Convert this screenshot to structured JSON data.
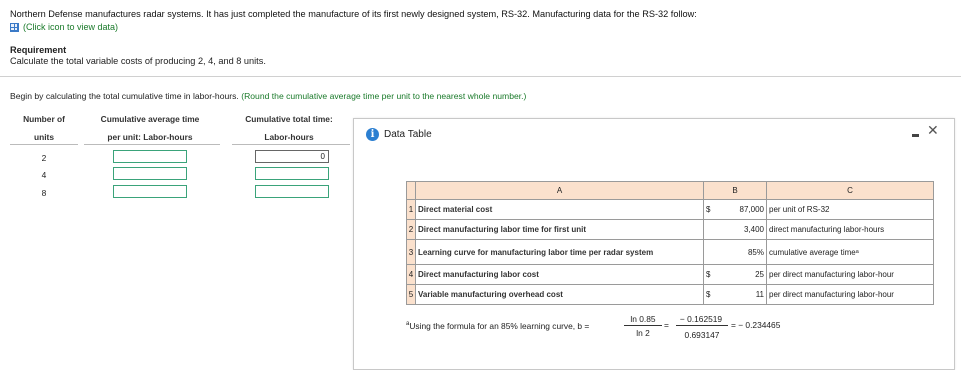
{
  "intro": "Northern Defense manufactures radar systems. It has just completed the manufacture of its first newly designed system, RS-32. Manufacturing data for the RS-32 follow:",
  "view_data_link": "(Click icon to view data)",
  "requirement_title": "Requirement",
  "requirement_text": "Calculate the total variable costs of producing 2, 4, and 8 units.",
  "instruction": "Begin by calculating the total cumulative time in labor-hours.",
  "instruction_hint": "(Round the cumulative average time per unit to the nearest whole number.)",
  "answer_table": {
    "headers": {
      "col1_line1": "Number of",
      "col1_line2": "units",
      "col2_line1": "Cumulative average time",
      "col2_line2": "per unit: Labor-hours",
      "col3_line1": "Cumulative total time:",
      "col3_line2": "Labor-hours"
    },
    "rows": [
      {
        "units": "2",
        "avg": "",
        "total": "0"
      },
      {
        "units": "4",
        "avg": "",
        "total": ""
      },
      {
        "units": "8",
        "avg": "",
        "total": ""
      }
    ]
  },
  "data_window": {
    "title": "Data Table",
    "info_icon": "i",
    "close_icon": "✕",
    "columns": [
      "A",
      "B",
      "C"
    ],
    "rows": [
      {
        "n": "1",
        "a": "Direct material cost",
        "dollar": "$",
        "b": "87,000",
        "c": "per unit of RS-32"
      },
      {
        "n": "2",
        "a": "Direct manufacturing labor time for first unit",
        "dollar": "",
        "b": "3,400",
        "c": "direct manufacturing labor-hours"
      },
      {
        "n": "3",
        "a": "Learning curve for manufacturing labor time per radar system",
        "dollar": "",
        "b": "85%",
        "c": "cumulative average timeᵃ"
      },
      {
        "n": "4",
        "a": "Direct manufacturing labor cost",
        "dollar": "$",
        "b": "25",
        "c": "per direct manufacturing labor-hour"
      },
      {
        "n": "5",
        "a": "Variable manufacturing overhead cost",
        "dollar": "$",
        "b": "11",
        "c": "per direct manufacturing labor-hour"
      }
    ],
    "footnote": {
      "marker": "a",
      "text": "Using the formula for an 85% learning curve, b =",
      "frac1_num": "ln 0.85",
      "frac1_den": "ln 2",
      "eq1": "=",
      "frac2_num": "− 0.162519",
      "frac2_den": "0.693147",
      "result": "= − 0.234465"
    }
  }
}
